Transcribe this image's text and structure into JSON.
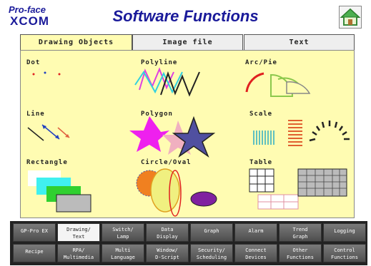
{
  "header": {
    "logo_top": "Pro-face",
    "logo_bottom": "COM",
    "logo_x": "X",
    "title": "Software Functions",
    "home_icon": "home-icon"
  },
  "tabs": [
    {
      "label": "Drawing Objects",
      "active": true
    },
    {
      "label": "Image file",
      "active": false
    },
    {
      "label": "Text",
      "active": false
    }
  ],
  "panel": {
    "cells": [
      {
        "label": "Dot"
      },
      {
        "label": "Polyline"
      },
      {
        "label": "Arc/Pie"
      },
      {
        "label": "Line"
      },
      {
        "label": "Polygon"
      },
      {
        "label": "Scale"
      },
      {
        "label": "Rectangle"
      },
      {
        "label": "Circle/Oval"
      },
      {
        "label": "Table"
      }
    ]
  },
  "buttons": [
    {
      "lines": [
        "GP-Pro EX"
      ]
    },
    {
      "lines": [
        "Drawing/",
        "Text"
      ],
      "active": true
    },
    {
      "lines": [
        "Switch/",
        "Lamp"
      ]
    },
    {
      "lines": [
        "Data",
        "Display"
      ]
    },
    {
      "lines": [
        "Graph"
      ]
    },
    {
      "lines": [
        "Alarm"
      ]
    },
    {
      "lines": [
        "Trend",
        "Graph"
      ]
    },
    {
      "lines": [
        "Logging"
      ]
    },
    {
      "lines": [
        "Recipe"
      ]
    },
    {
      "lines": [
        "RPA/",
        "Multimedia"
      ]
    },
    {
      "lines": [
        "Multi",
        "Language"
      ]
    },
    {
      "lines": [
        "Window/",
        "D-Script"
      ]
    },
    {
      "lines": [
        "Security/",
        "Scheduling"
      ]
    },
    {
      "lines": [
        "Connect",
        "Devices"
      ]
    },
    {
      "lines": [
        "Other",
        "Functions"
      ]
    },
    {
      "lines": [
        "Control",
        "Functions"
      ]
    }
  ],
  "colors": {
    "title": "#1a1a9a",
    "panel_bg": "#fffcb2",
    "logo_red": "#e02010"
  }
}
